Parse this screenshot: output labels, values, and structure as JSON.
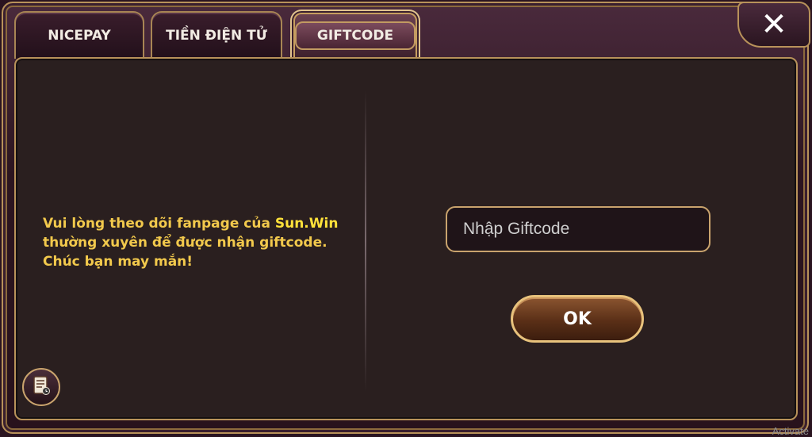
{
  "tabs": [
    {
      "label": "NICEPAY",
      "active": false
    },
    {
      "label": "TIỀN ĐIỆN TỬ",
      "active": false
    },
    {
      "label": "GIFTCODE",
      "active": true
    }
  ],
  "close_label": "✕",
  "info": {
    "line1_prefix": "Vui lòng theo dõi fanpage của ",
    "brand": "Sun.Win",
    "line2": "thường xuyên để được nhận giftcode.",
    "line3": "Chúc bạn may mắn!"
  },
  "giftcode_input": {
    "placeholder": "Nhập Giftcode",
    "value": ""
  },
  "ok_label": "OK",
  "history_icon": "scroll-history-icon",
  "watermark": "Activate",
  "colors": {
    "accent_gold": "#c9a36d",
    "brand_yellow": "#ffe23a",
    "info_text": "#f2c94c"
  }
}
